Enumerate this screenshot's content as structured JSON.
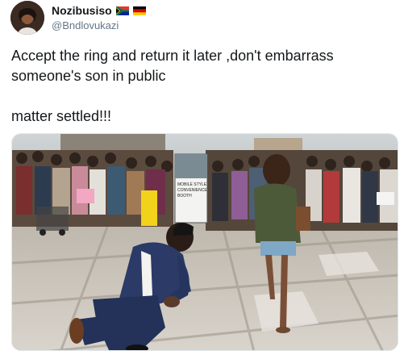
{
  "user": {
    "name": "Nozibusiso",
    "handle": "@Bndlovukazi",
    "flags": [
      "south-africa-flag-icon",
      "germany-flag-icon"
    ]
  },
  "tweet": {
    "text": "Accept the ring and return it later ,don't embarrass\nsomeone's son in public\n\nmatter settled!!!"
  },
  "photo": {
    "sign_text": [
      "MOBILE STYLE",
      "CONVENIENCE",
      "BOOTH"
    ],
    "description_icon": "proposal-photo"
  }
}
